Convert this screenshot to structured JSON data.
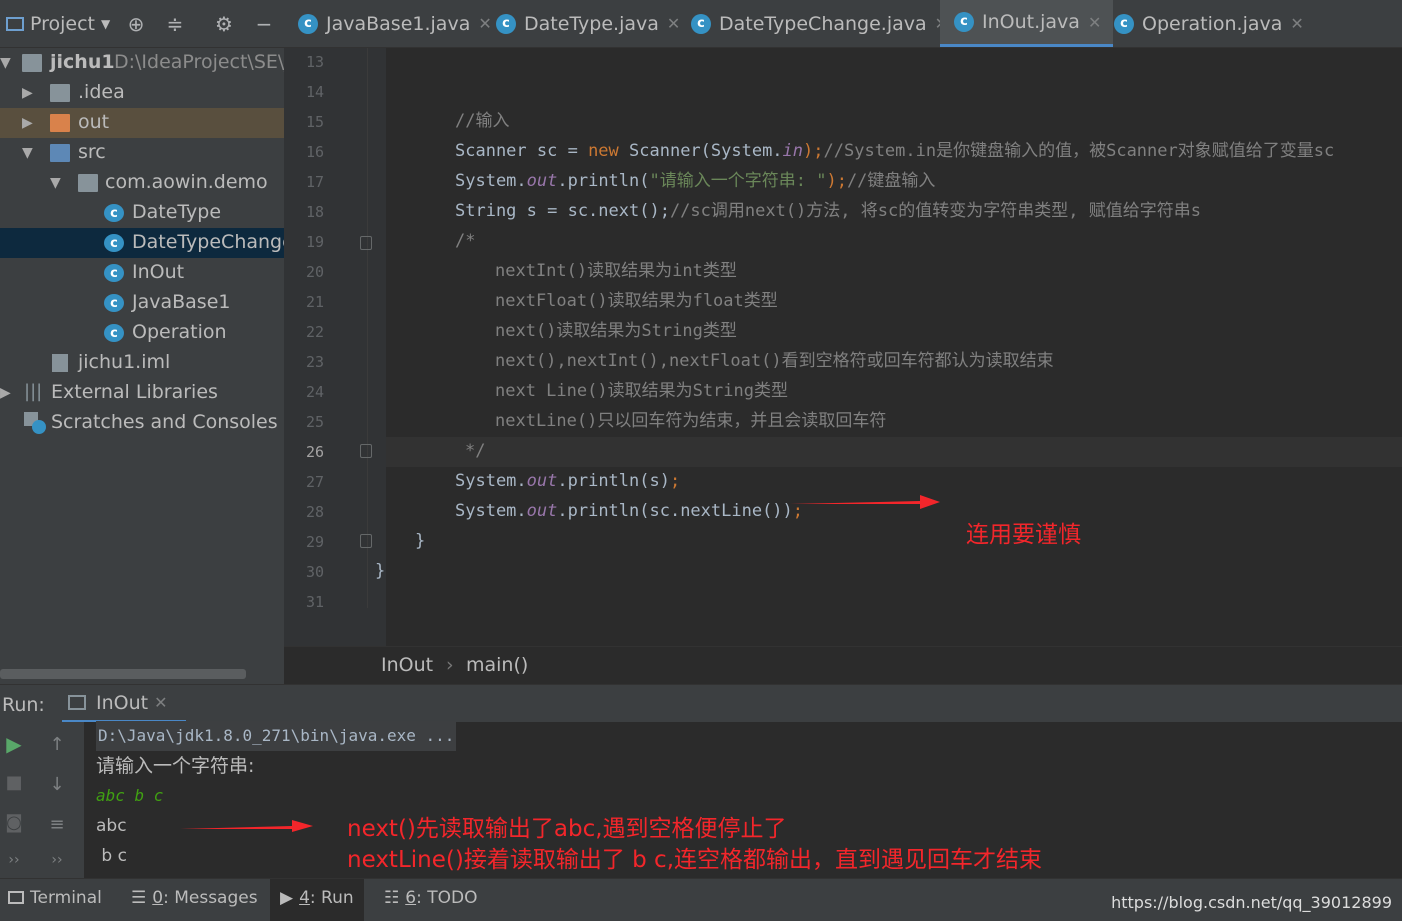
{
  "project_panel": {
    "title": "Project",
    "tree": [
      {
        "label": "jichu1",
        "path": "D:\\IdeaProject\\SE\\ji"
      },
      {
        "label": ".idea"
      },
      {
        "label": "out"
      },
      {
        "label": "src"
      },
      {
        "label": "com.aowin.demo"
      },
      {
        "label": "DateType"
      },
      {
        "label": "DateTypeChange"
      },
      {
        "label": "InOut"
      },
      {
        "label": "JavaBase1"
      },
      {
        "label": "Operation"
      },
      {
        "label": "jichu1.iml"
      },
      {
        "label": "External Libraries"
      },
      {
        "label": "Scratches and Consoles"
      }
    ]
  },
  "tabs": [
    {
      "label": "JavaBase1.java"
    },
    {
      "label": "DateType.java"
    },
    {
      "label": "DateTypeChange.java"
    },
    {
      "label": "InOut.java",
      "active": true
    },
    {
      "label": "Operation.java"
    }
  ],
  "editor": {
    "line_numbers": [
      "13",
      "14",
      "15",
      "16",
      "17",
      "18",
      "19",
      "20",
      "21",
      "22",
      "23",
      "24",
      "25",
      "26",
      "27",
      "28",
      "29",
      "30",
      "31"
    ],
    "current_line": "26",
    "lines": {
      "l15": "//输入",
      "l16_a": "Scanner sc = ",
      "l16_kw": "new",
      "l16_b": " Scanner(System.",
      "l16_fld": "in",
      "l16_c": ");",
      "l16_cm": "//System.in是你键盘输入的值，被Scanner对象赋值给了变量sc",
      "l17_a": "System.",
      "l17_fld": "out",
      "l17_b": ".println(",
      "l17_st": "\"请输入一个字符串: \"",
      "l17_c": ");",
      "l17_cm": "//键盘输入",
      "l18_a": "String s = sc.next();",
      "l18_cm": "//sc调用next()方法, 将sc的值转变为字符串类型, 赋值给字符串s",
      "l19": "/*",
      "l20": "nextInt()读取结果为int类型",
      "l21": "nextFloat()读取结果为float类型",
      "l22": "next()读取结果为String类型",
      "l23": "next(),nextInt(),nextFloat()看到空格符或回车符都认为读取结束",
      "l24": "next Line()读取结果为String类型",
      "l25": "nextLine()只以回车符为结束，并且会读取回车符",
      "l26": "*/",
      "l27_a": "System.",
      "l27_fld": "out",
      "l27_b": ".println(s)",
      "l27_c": ";",
      "l28_a": "System.",
      "l28_fld": "out",
      "l28_b": ".println(sc.nextLine())",
      "l28_c": ";",
      "l29": "}",
      "l30": "}"
    },
    "annotation": "连用要谨慎"
  },
  "breadcrumb": {
    "class": "InOut",
    "sep": "›",
    "method": "main()"
  },
  "run_panel": {
    "label": "Run:",
    "tab": "InOut",
    "console": {
      "cmd": "D:\\Java\\jdk1.8.0_271\\bin\\java.exe ...",
      "prompt": "请输入一个字符串:",
      "input": "abc b c",
      "out1": "abc",
      "out2": " b c"
    },
    "annotation1": "next()先读取输出了abc,遇到空格便停止了",
    "annotation2": "nextLine()接着读取输出了  b  c,连空格都输出，直到遇见回车才结束"
  },
  "bottom_bar": {
    "terminal": "Terminal",
    "messages_num": "0",
    "messages": ": Messages",
    "run_num": "4",
    "run": ": Run",
    "todo_num": "6",
    "todo": ": TODO",
    "watermark": "https://blog.csdn.net/qq_39012899"
  },
  "colors": {
    "annotation": "#f3262b",
    "accent": "#4a88c7"
  }
}
